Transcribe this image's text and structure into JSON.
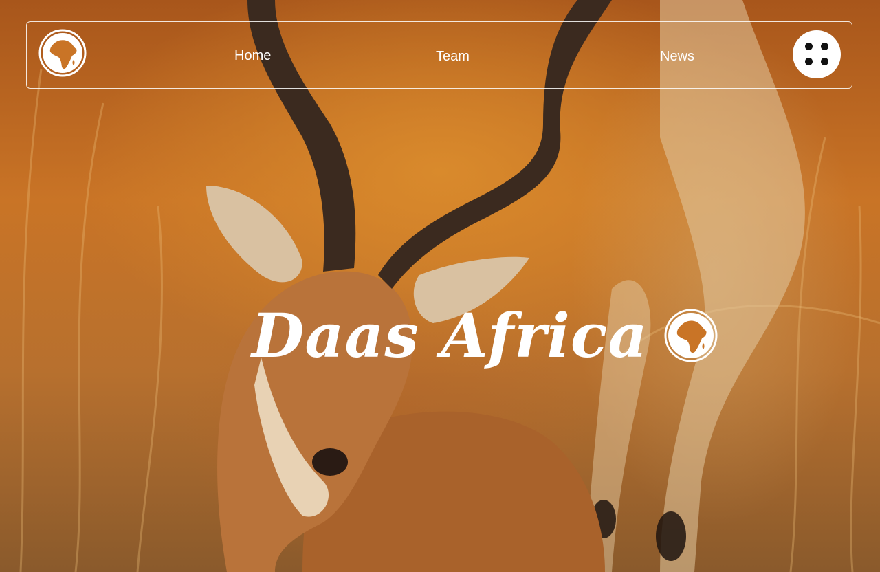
{
  "nav": {
    "logo_icon": "globe-africa-icon",
    "links": [
      {
        "label": "Home"
      },
      {
        "label": "Team"
      },
      {
        "label": "News"
      }
    ],
    "menu_icon": "four-dots-grid-icon"
  },
  "hero": {
    "title": "Daas Africa",
    "title_icon": "globe-africa-icon",
    "background": "photo of an impala grooming in golden grass"
  },
  "colors": {
    "text": "#ffffff",
    "menu_button_bg": "#ffffff",
    "menu_dots": "#111111",
    "background_warm": "#c97426"
  }
}
